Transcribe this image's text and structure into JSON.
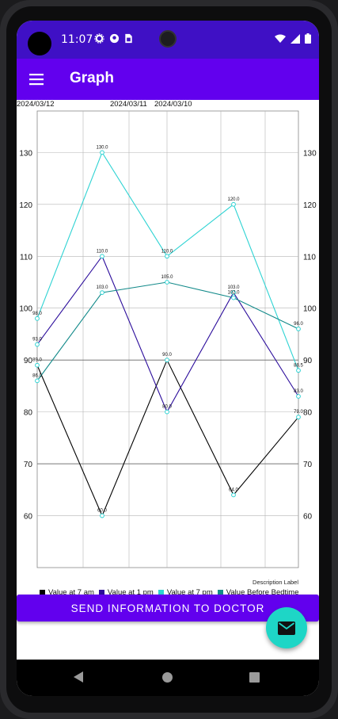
{
  "status_bar": {
    "time": "11:07",
    "icons": [
      "gear-icon",
      "notification-icon",
      "sim-icon"
    ],
    "right_icons": [
      "wifi-icon",
      "signal-icon",
      "battery-icon"
    ]
  },
  "app_bar": {
    "title": "Graph",
    "menu_icon": "menu-icon"
  },
  "colors": {
    "status_bar": "#3f10c5",
    "app_bar": "#6200ee",
    "fab": "#1ed6c6",
    "series_7am": "#000000",
    "series_1pm": "#2b0c9b",
    "series_7pm": "#2ed3d3",
    "series_bedtime": "#138a8a"
  },
  "chart_data": {
    "type": "line",
    "x": [
      0,
      1,
      2,
      3,
      4
    ],
    "top_labels": [
      "2024/03/12",
      "2024/03/11",
      "2024/03/10"
    ],
    "ylim": [
      50,
      138
    ],
    "y_ticks": [
      60,
      70,
      80,
      90,
      100,
      110,
      120,
      130
    ],
    "grid": true,
    "description_label": "Description Label",
    "series": [
      {
        "name": "Value at 7 am",
        "values": [
          89.0,
          60.0,
          90.0,
          64.0,
          79.0
        ],
        "labels": [
          "89.0",
          "60.0",
          "90.0",
          "64.0",
          "79.0"
        ],
        "color": "#000000"
      },
      {
        "name": "Value at 1 pm",
        "values": [
          93.0,
          110.0,
          80.0,
          103.0,
          83.0
        ],
        "labels": [
          "93.0",
          "110.0",
          "80.0",
          "103.0",
          "83.0"
        ],
        "color": "#2b0c9b"
      },
      {
        "name": "Value at 7 pm",
        "values": [
          98.0,
          130.0,
          110.0,
          120.0,
          88.0
        ],
        "labels": [
          "98.0",
          "130.0",
          "110.0",
          "120.0",
          "88.5"
        ],
        "color": "#2ed3d3"
      },
      {
        "name": "Value Before Bedtime",
        "values": [
          86.0,
          103.0,
          105.0,
          102.0,
          96.0
        ],
        "labels": [
          "86.0",
          "103.0",
          "105.0",
          "102.0",
          "96.0"
        ],
        "color": "#138a8a"
      }
    ],
    "legend_position": "bottom-left"
  },
  "buttons": {
    "send": "SEND INFORMATION TO DOCTOR",
    "fab_icon": "mail-icon"
  },
  "nav_bar": {
    "back_icon": "back-icon",
    "home_icon": "home-icon",
    "recent_icon": "recents-icon"
  }
}
